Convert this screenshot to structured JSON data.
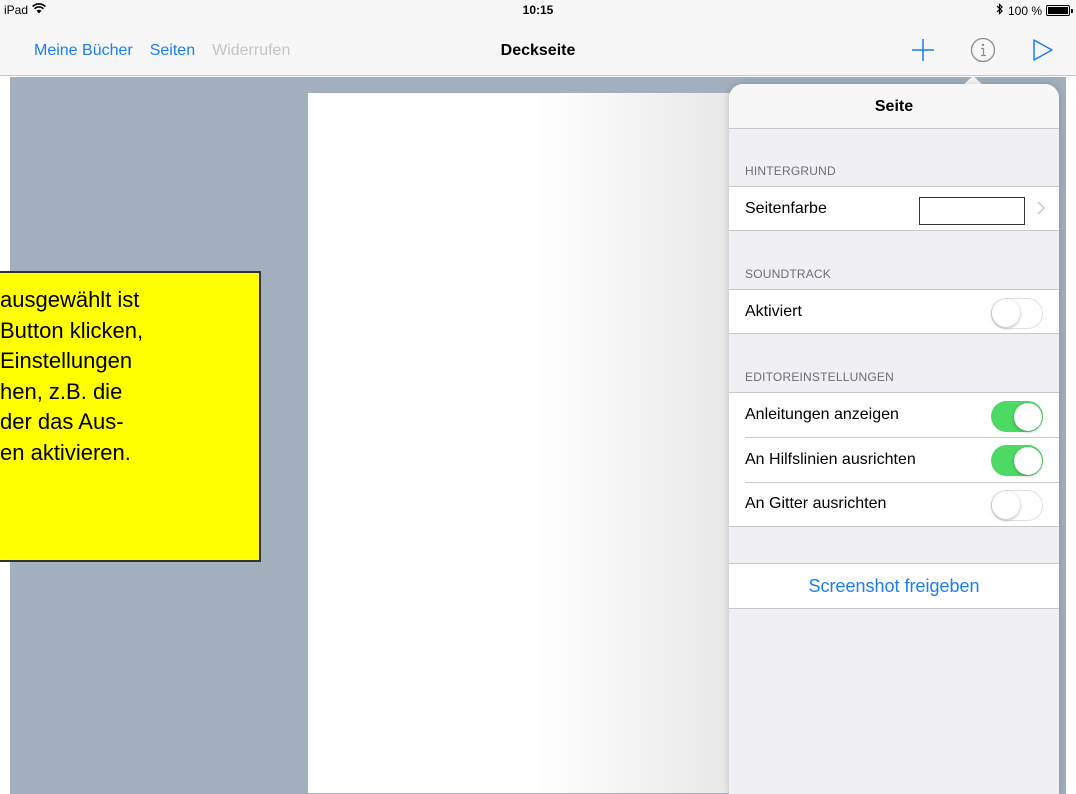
{
  "status_bar": {
    "device": "iPad",
    "time": "10:15",
    "battery": "100 %"
  },
  "nav": {
    "my_books": "Meine Bücher",
    "pages": "Seiten",
    "undo": "Widerrufen",
    "title": "Deckseite",
    "icons": [
      "plus-icon",
      "info-icon",
      "play-icon"
    ]
  },
  "callout": {
    "lines": [
      "ausgewählt ist",
      "Button klicken,",
      "Einstellungen",
      "hen, z.B. die",
      "der das Aus-",
      "en aktivieren."
    ]
  },
  "popover": {
    "title": "Seite",
    "background_section": {
      "header": "HINTERGRUND",
      "page_color_label": "Seitenfarbe",
      "page_color_value": "#ffffff"
    },
    "soundtrack_section": {
      "header": "SOUNDTRACK",
      "enabled_label": "Aktiviert",
      "enabled": false
    },
    "editor_section": {
      "header": "EDITOREINSTELLUNGEN",
      "rows": [
        {
          "label": "Anleitungen anzeigen",
          "on": true
        },
        {
          "label": "An Hilfslinien ausrichten",
          "on": true
        },
        {
          "label": "An Gitter ausrichten",
          "on": false
        }
      ]
    },
    "share_label": "Screenshot freigeben"
  },
  "colors": {
    "accent": "#1a7ef2",
    "toggle_on": "#4cd964",
    "canvas_bg": "#a2afbd",
    "callout_bg": "#ffff00"
  }
}
